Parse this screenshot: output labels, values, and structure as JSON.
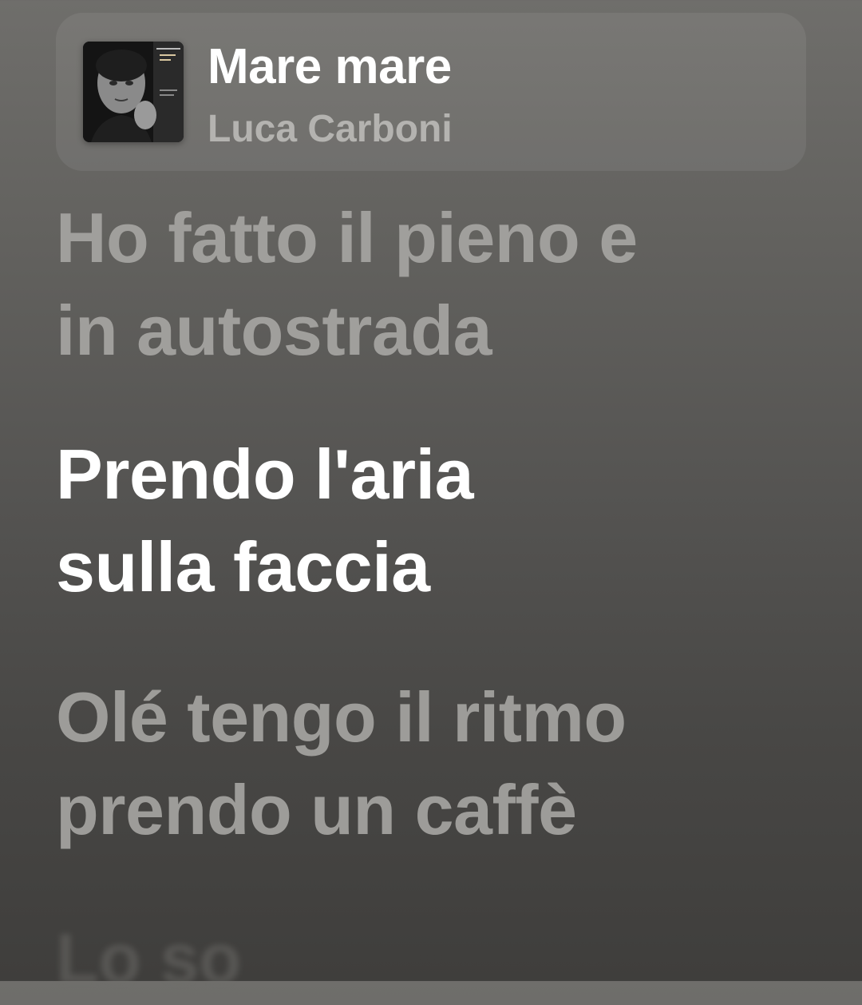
{
  "now_playing": {
    "title": "Mare mare",
    "artist": "Luca Carboni",
    "artwork_icon": "album-artwork"
  },
  "lyrics": [
    {
      "state": "past",
      "lines": [
        "Ho fatto il pieno e",
        "in autostrada"
      ]
    },
    {
      "state": "active",
      "lines": [
        "Prendo l'aria",
        "sulla faccia"
      ]
    },
    {
      "state": "upcoming",
      "lines": [
        "Olé tengo il ritmo",
        "prendo un caffè"
      ]
    },
    {
      "state": "faded",
      "lines": [
        "Lo so"
      ]
    }
  ],
  "colors": {
    "active": "#ffffff",
    "inactive": "#a09f9c",
    "background_top": "#6f6e6b",
    "background_bottom": "#3f3e3c"
  }
}
